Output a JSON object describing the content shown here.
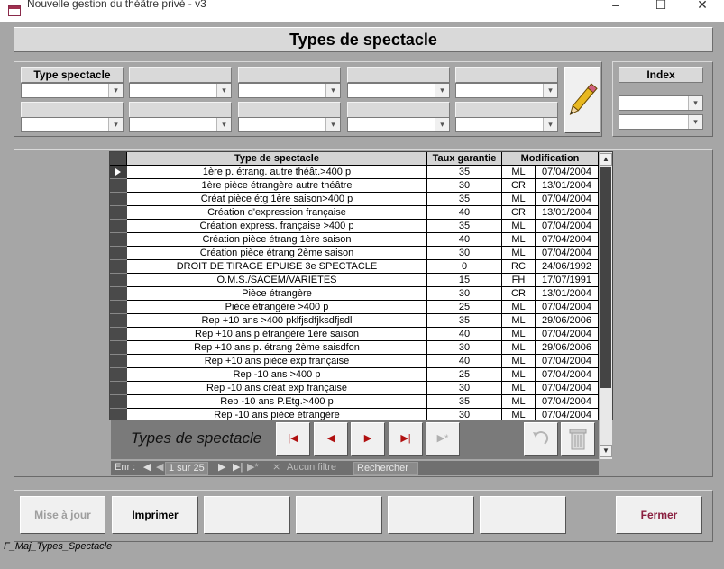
{
  "window": {
    "title": "Nouvelle gestion du théâtre privé - v3",
    "minimize": "–",
    "maximize": "☐",
    "close": "✕"
  },
  "form": {
    "title": "Types de spectacle",
    "status_text": "F_Maj_Types_Spectacle"
  },
  "filters": {
    "type_label": "Type spectacle",
    "index_label": "Index",
    "dropdown_glyph": "▾"
  },
  "grid": {
    "columns": [
      "Type de spectacle",
      "Taux garantie",
      "Modification"
    ],
    "rows": [
      {
        "type": "1ère p. étrang. autre théât.>400 p",
        "taux": "35",
        "code": "ML",
        "date": "07/04/2004"
      },
      {
        "type": "1ère pièce étrangère autre théâtre",
        "taux": "30",
        "code": "CR",
        "date": "13/01/2004"
      },
      {
        "type": "Créat pièce étg 1ère saison>400 p",
        "taux": "35",
        "code": "ML",
        "date": "07/04/2004"
      },
      {
        "type": "Création d'expression française",
        "taux": "40",
        "code": "CR",
        "date": "13/01/2004"
      },
      {
        "type": "Création express. française >400 p",
        "taux": "35",
        "code": "ML",
        "date": "07/04/2004"
      },
      {
        "type": "Création pièce étrang 1ère saison",
        "taux": "40",
        "code": "ML",
        "date": "07/04/2004"
      },
      {
        "type": "Création pièce étrang 2ème saison",
        "taux": "30",
        "code": "ML",
        "date": "07/04/2004"
      },
      {
        "type": "DROIT DE TIRAGE EPUISE 3e SPECTACLE",
        "taux": "0",
        "code": "RC",
        "date": "24/06/1992"
      },
      {
        "type": "O.M.S./SACEM/VARIETES",
        "taux": "15",
        "code": "FH",
        "date": "17/07/1991"
      },
      {
        "type": "Pièce étrangère",
        "taux": "30",
        "code": "CR",
        "date": "13/01/2004"
      },
      {
        "type": "Pièce étrangère >400 p",
        "taux": "25",
        "code": "ML",
        "date": "07/04/2004"
      },
      {
        "type": "Rep +10 ans >400 pklfjsdfjksdfjsdl",
        "taux": "35",
        "code": "ML",
        "date": "29/06/2006"
      },
      {
        "type": "Rep +10 ans p étrangère 1ère saison",
        "taux": "40",
        "code": "ML",
        "date": "07/04/2004"
      },
      {
        "type": "Rep +10 ans p. étrang 2ème saisdfon",
        "taux": "30",
        "code": "ML",
        "date": "29/06/2006"
      },
      {
        "type": "Rep +10 ans pièce exp française",
        "taux": "40",
        "code": "ML",
        "date": "07/04/2004"
      },
      {
        "type": "Rep -10 ans >400 p",
        "taux": "25",
        "code": "ML",
        "date": "07/04/2004"
      },
      {
        "type": "Rep -10 ans créat exp française",
        "taux": "30",
        "code": "ML",
        "date": "07/04/2004"
      },
      {
        "type": "Rep -10 ans P.Etg.>400 p",
        "taux": "35",
        "code": "ML",
        "date": "07/04/2004"
      },
      {
        "type": "Rep -10 ans pièce étrangère",
        "taux": "30",
        "code": "ML",
        "date": "07/04/2004"
      }
    ]
  },
  "nav": {
    "title": "Types de spectacle",
    "first": "|◀",
    "prev": "◀",
    "next": "▶",
    "last": "▶|",
    "new": "▶*"
  },
  "record_nav": {
    "label": "Enr :",
    "first": "|◀",
    "prev": "◀",
    "position": "1 sur 25",
    "next": "▶",
    "last": "▶|",
    "new": "▶*",
    "filter": "Aucun filtre",
    "search": "Rechercher"
  },
  "buttons": {
    "update": "Mise à jour",
    "print": "Imprimer",
    "close": "Fermer"
  }
}
